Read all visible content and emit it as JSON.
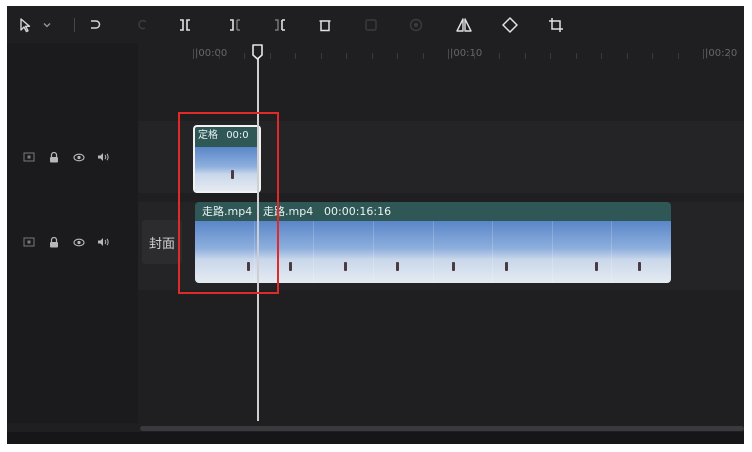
{
  "toolbar": {
    "tools": [
      {
        "name": "select-arrow-icon",
        "enabled": true
      },
      {
        "name": "dropdown-chevron-icon",
        "enabled": true
      },
      {
        "name": "undo-icon",
        "enabled": true
      },
      {
        "name": "redo-icon",
        "enabled": false
      },
      {
        "name": "split-icon",
        "enabled": true
      },
      {
        "name": "split-left-icon",
        "enabled": true
      },
      {
        "name": "split-right-icon",
        "enabled": true
      },
      {
        "name": "delete-icon",
        "enabled": true
      },
      {
        "name": "freeze-frame-icon",
        "enabled": false
      },
      {
        "name": "record-icon",
        "enabled": false
      },
      {
        "name": "mirror-icon",
        "enabled": true
      },
      {
        "name": "rotate-icon",
        "enabled": true
      },
      {
        "name": "crop-icon",
        "enabled": true
      }
    ]
  },
  "ruler": {
    "labels": [
      "|00:00",
      "|00:10",
      "|00:20"
    ]
  },
  "tracks": [
    {
      "name": "overlay-track",
      "icons": [
        "cover-icon",
        "lock-icon",
        "eye-icon",
        "audio-icon"
      ]
    },
    {
      "name": "main-track",
      "icons": [
        "cover-icon",
        "lock-icon",
        "eye-icon",
        "audio-icon"
      ]
    }
  ],
  "cover_label": "封面",
  "freeze_clip": {
    "label": "定格",
    "time": "00:0"
  },
  "main_clip": {
    "segments": [
      {
        "label": "走路.mp4"
      },
      {
        "label": "走路.mp4",
        "duration": "00:00:16:16"
      }
    ],
    "thumbnail_count": 8
  },
  "colors": {
    "background": "#1f1f21",
    "clip": "#2f5756",
    "highlight": "#e02a2a"
  }
}
